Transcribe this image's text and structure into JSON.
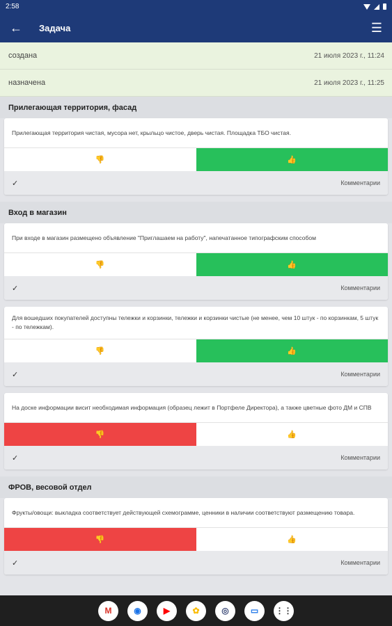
{
  "status_bar": {
    "time": "2:58"
  },
  "app_bar": {
    "title": "Задача"
  },
  "statuses": [
    {
      "label": "создана",
      "date": "21 июля 2023 г., 11:24"
    },
    {
      "label": "назначена",
      "date": "21 июля 2023 г., 11:25"
    }
  ],
  "sections": [
    {
      "title": "Прилегающая территория, фасад",
      "items": [
        {
          "text": "Прилегающая территория чистая, мусора нет, крыльцо чистое, дверь чистая. Площадка ТБО чистая.",
          "vote": "up",
          "comment_label": "Комментарии"
        }
      ]
    },
    {
      "title": "Вход в магазин",
      "items": [
        {
          "text": "При входе в магазин размещено объявление \"Приглашаем на работу\", напечатанное типографским способом",
          "vote": "up",
          "comment_label": "Комментарии"
        },
        {
          "text": "Для вошедших покупателей доступны тележки и корзинки, тележки и корзинки чистые (не менее, чем 10 штук - по корзинкам, 5 штук - по тележкам).",
          "vote": "up",
          "comment_label": "Комментарии"
        },
        {
          "text": "На доске информации висит необходимая информация (образец лежит в Портфеле Директора), а также цветные фото ДМ и СПВ",
          "vote": "down",
          "comment_label": "Комментарии"
        }
      ]
    },
    {
      "title": "ФРОВ, весовой отдел",
      "items": [
        {
          "text": "Фрукты/овощи: выкладка соответствует действующей схемограмме, ценники в наличии соответствуют размещению товара.",
          "vote": "down",
          "comment_label": "Комментарии"
        }
      ]
    }
  ],
  "icons": {
    "back": "arrow-back-icon",
    "menu": "hamburger-menu-icon",
    "thumb_down": "thumb-down-icon",
    "thumb_up": "thumb-up-icon",
    "check": "check-icon"
  },
  "colors": {
    "app_bar": "#1e3a78",
    "thumb_up_active": "#27c05b",
    "thumb_down_active": "#ee4444",
    "status_row_bg": "#eaf3df"
  },
  "dock_apps": [
    {
      "name": "gmail",
      "glyph": "M",
      "color": "#d93025"
    },
    {
      "name": "chrome",
      "glyph": "◉",
      "color": "#1a73e8"
    },
    {
      "name": "youtube",
      "glyph": "▶",
      "color": "#ff0000"
    },
    {
      "name": "photos",
      "glyph": "✿",
      "color": "#fbbc04"
    },
    {
      "name": "camera",
      "glyph": "◎",
      "color": "#3c4a78"
    },
    {
      "name": "messages",
      "glyph": "▭",
      "color": "#1a73e8"
    },
    {
      "name": "apps",
      "glyph": "⋮⋮",
      "color": "#333"
    }
  ]
}
